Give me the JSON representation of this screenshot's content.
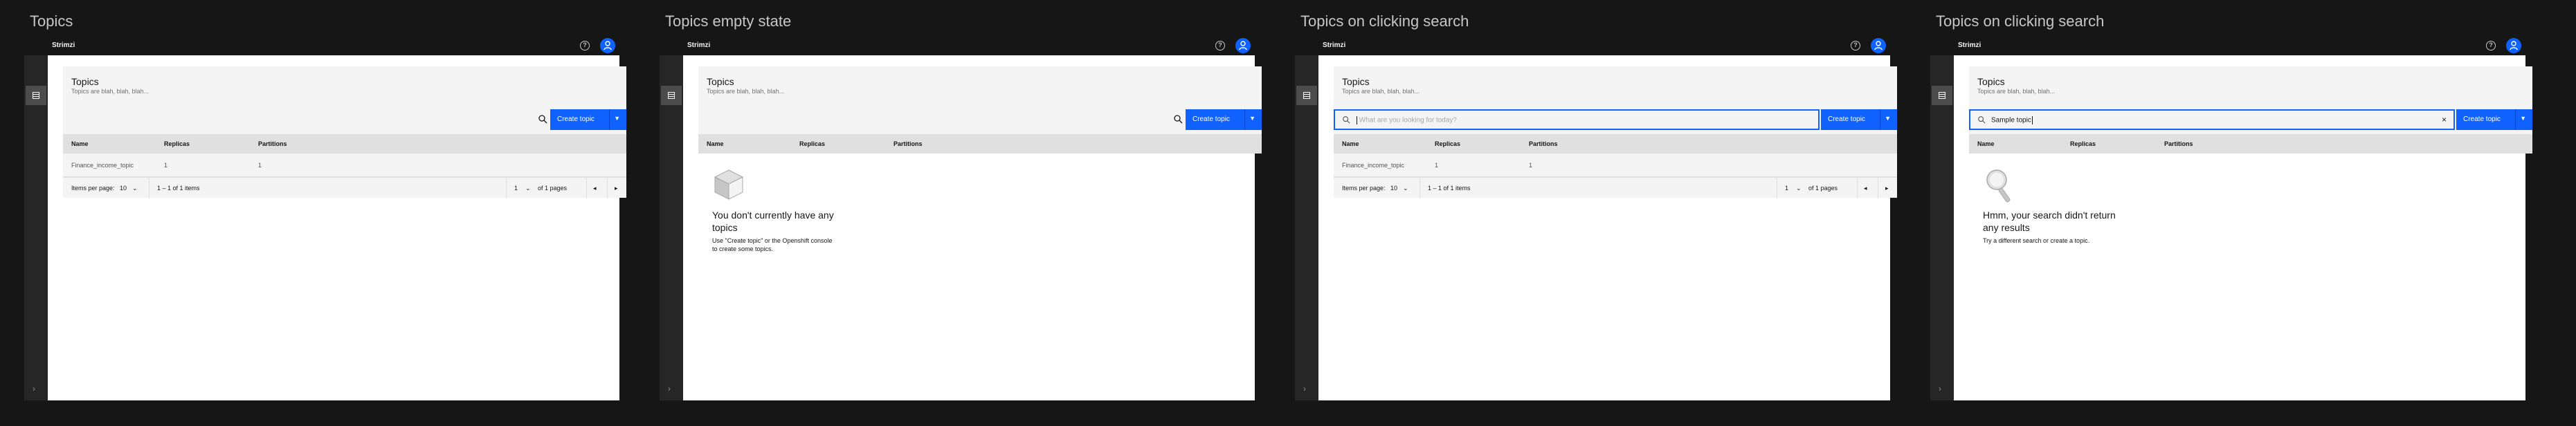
{
  "frames": [
    {
      "title": "Topics",
      "app_name": "Strimzi",
      "page_title": "Topics",
      "page_subtitle": "Topics are blah, blah, blah...",
      "create_label": "Create topic",
      "columns": [
        "Name",
        "Replicas",
        "Partitions"
      ],
      "rows": [
        {
          "name": "Finance_income_topic",
          "replicas": "1",
          "partitions": "1"
        }
      ],
      "pager": {
        "items_per_page_label": "Items per page:",
        "items_per_page": "10",
        "range": "1 – 1 of 1 items",
        "page": "1",
        "of_pages": "of 1 pages"
      }
    },
    {
      "title": "Topics empty state",
      "app_name": "Strimzi",
      "page_title": "Topics",
      "page_subtitle": "Topics are blah, blah, blah...",
      "create_label": "Create topic",
      "columns": [
        "Name",
        "Replicas",
        "Partitions"
      ],
      "empty": {
        "title": "You don't currently have any topics",
        "description": "Use \"Create topic\" or the Openshift console to create some topics."
      }
    },
    {
      "title": "Topics on clicking search",
      "app_name": "Strimzi",
      "page_title": "Topics",
      "page_subtitle": "Topics are blah, blah, blah...",
      "create_label": "Create topic",
      "search_placeholder": "What are you looking for today?",
      "columns": [
        "Name",
        "Replicas",
        "Partitions"
      ],
      "rows": [
        {
          "name": "Finance_income_topic",
          "replicas": "1",
          "partitions": "1"
        }
      ],
      "pager": {
        "items_per_page_label": "Items per page:",
        "items_per_page": "10",
        "range": "1 – 1 of 1 items",
        "page": "1",
        "of_pages": "of 1 pages"
      }
    },
    {
      "title": "Topics on clicking search",
      "app_name": "Strimzi",
      "page_title": "Topics",
      "page_subtitle": "Topics are blah, blah, blah...",
      "create_label": "Create topic",
      "search_value": "Sample topic",
      "columns": [
        "Name",
        "Replicas",
        "Partitions"
      ],
      "empty": {
        "title": "Hmm, your search didn't return any results",
        "description": "Try a different search or create a topic."
      }
    }
  ],
  "colors": {
    "background": "#161616",
    "accent": "#0f62fe",
    "surface": "#f4f4f4",
    "header_row": "#e0e0e0"
  },
  "icons": [
    "help-icon",
    "user-avatar-icon",
    "grid-icon",
    "search-icon",
    "chevron-down-icon",
    "chevron-right-icon",
    "close-icon",
    "empty-box-illustration",
    "magnifier-illustration"
  ]
}
